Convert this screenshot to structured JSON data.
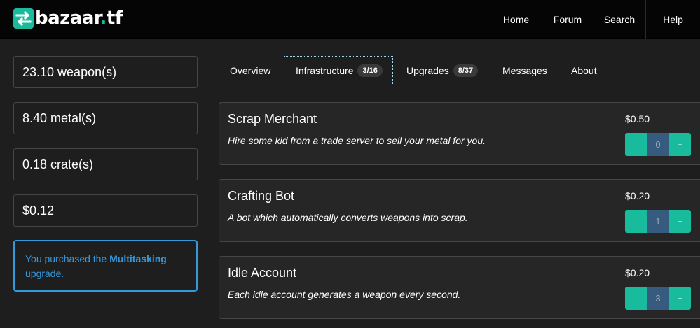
{
  "brand": {
    "name": "bazaar",
    "dot": ".",
    "tld": "tf",
    "icon": "exchange-arrows-icon",
    "accent": "#18bc9c"
  },
  "nav": [
    {
      "label": "Home"
    },
    {
      "label": "Forum"
    },
    {
      "label": "Search"
    },
    {
      "label": "Help"
    }
  ],
  "stats": [
    {
      "value": "23.10 weapon(s)"
    },
    {
      "value": "8.40 metal(s)"
    },
    {
      "value": "0.18 crate(s)"
    },
    {
      "value": "$0.12"
    }
  ],
  "alert": {
    "prefix": "You purchased the ",
    "highlight": "Multitasking",
    "suffix": " upgrade.",
    "color": "#3498db"
  },
  "tabs": [
    {
      "label": "Overview",
      "badge": ""
    },
    {
      "label": "Infrastructure",
      "badge": "3/16",
      "active": true
    },
    {
      "label": "Upgrades",
      "badge": "8/37"
    },
    {
      "label": "Messages",
      "badge": ""
    },
    {
      "label": "About",
      "badge": ""
    }
  ],
  "items": [
    {
      "title": "Scrap Merchant",
      "description": "Hire some kid from a trade server to sell your metal for you.",
      "price": "$0.50",
      "count": "0",
      "minus": "-",
      "plus": "+"
    },
    {
      "title": "Crafting Bot",
      "description": "A bot which automatically converts weapons into scrap.",
      "price": "$0.20",
      "count": "1",
      "minus": "-",
      "plus": "+"
    },
    {
      "title": "Idle Account",
      "description": "Each idle account generates a weapon every second.",
      "price": "$0.20",
      "count": "3",
      "minus": "-",
      "plus": "+"
    }
  ]
}
